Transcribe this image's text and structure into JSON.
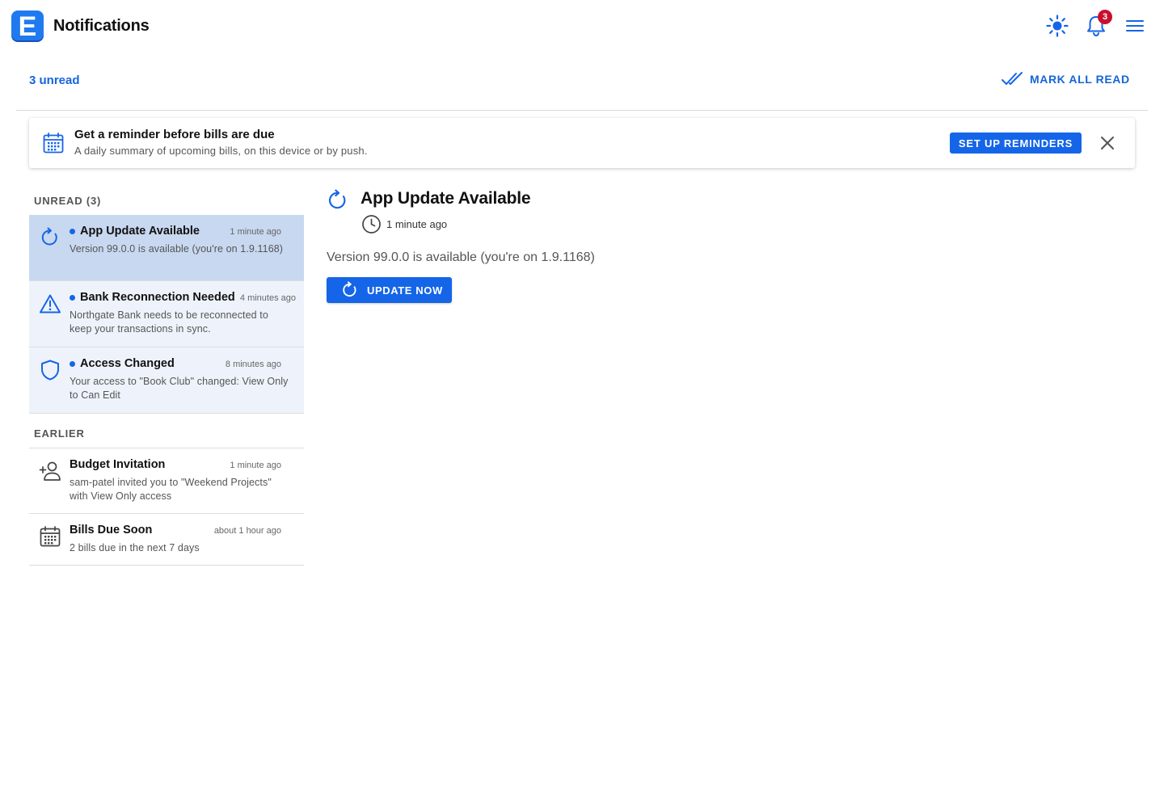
{
  "header": {
    "title": "Notifications",
    "logo_letter": "E",
    "notification_badge": "3",
    "brand_color": "#1565e8"
  },
  "toolbar": {
    "unread_label": "3 unread",
    "mark_all_label": "MARK ALL READ"
  },
  "banner": {
    "title": "Get a reminder before bills are due",
    "subtitle": "A daily summary of upcoming bills, on this device or by push.",
    "button_label": "SET UP REMINDERS"
  },
  "sections": {
    "unread_label": "UNREAD (3)",
    "earlier_label": "EARLIER"
  },
  "unread_items": [
    {
      "icon": "refresh-icon",
      "title": "App Update Available",
      "time": "1 minute ago",
      "body": "Version 99.0.0 is available (you're on 1.9.1168)"
    },
    {
      "icon": "warning-icon",
      "title": "Bank Reconnection Needed",
      "time": "4 minutes ago",
      "body": "Northgate Bank needs to be reconnected to keep your transactions in sync."
    },
    {
      "icon": "shield-icon",
      "title": "Access Changed",
      "time": "8 minutes ago",
      "body": "Your access to \"Book Club\" changed: View Only to Can Edit"
    }
  ],
  "earlier_items": [
    {
      "icon": "add-person-icon",
      "title": "Budget Invitation",
      "time": "1 minute ago",
      "body": "sam-patel invited you to \"Weekend Projects\" with View Only access"
    },
    {
      "icon": "calendar-icon",
      "title": "Bills Due Soon",
      "time": "about 1 hour ago",
      "body": "2 bills due in the next 7 days"
    }
  ],
  "detail": {
    "title": "App Update Available",
    "time": "1 minute ago",
    "body": "Version 99.0.0 is available (you're on 1.9.1168)",
    "button_label": "UPDATE NOW"
  }
}
